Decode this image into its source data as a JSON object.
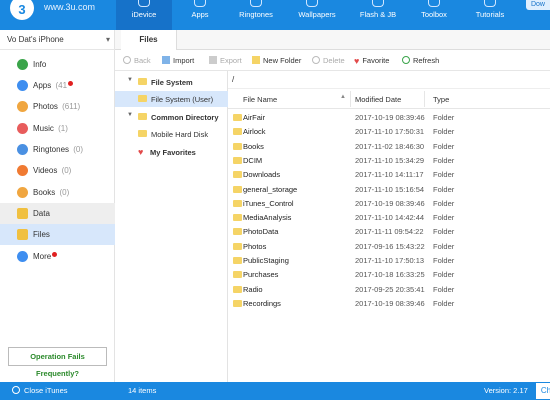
{
  "app": {
    "logo_text": "www.3u.com",
    "top_button": "Dow",
    "nav": [
      {
        "label": "iDevice",
        "active": true
      },
      {
        "label": "Apps"
      },
      {
        "label": "Ringtones"
      },
      {
        "label": "Wallpapers"
      },
      {
        "label": "Flash & JB"
      },
      {
        "label": "Toolbox"
      },
      {
        "label": "Tutorials"
      }
    ]
  },
  "sidebar": {
    "device_name": "Vo Dat's iPhone",
    "items": [
      {
        "label": "Info",
        "count": "",
        "icon": "info-icon",
        "color": "#3aa44a"
      },
      {
        "label": "Apps",
        "count": "(41",
        "icon": "apps-icon",
        "color": "#3e8ef0",
        "dot": true
      },
      {
        "label": "Photos",
        "count": "(611)",
        "icon": "photos-icon",
        "color": "#f0a640"
      },
      {
        "label": "Music",
        "count": "(1)",
        "icon": "music-icon",
        "color": "#e85c5c"
      },
      {
        "label": "Ringtones",
        "count": "(0)",
        "icon": "bell-icon",
        "color": "#4a90e2"
      },
      {
        "label": "Videos",
        "count": "(0)",
        "icon": "video-icon",
        "color": "#f07a32"
      },
      {
        "label": "Books",
        "count": "(0)",
        "icon": "book-icon",
        "color": "#f0a640"
      },
      {
        "label": "Data",
        "count": "",
        "icon": "data-icon",
        "color": "#f0c040"
      },
      {
        "label": "Files",
        "count": "",
        "icon": "files-icon",
        "color": "#f0c040"
      },
      {
        "label": "More",
        "count": "",
        "icon": "more-icon",
        "color": "#3e8ef0",
        "dot": true
      }
    ],
    "operation_fails": "Operation Fails Frequently?"
  },
  "tabs": {
    "files": "Files"
  },
  "toolbar": {
    "back": "Back",
    "import": "Import",
    "export": "Export",
    "new_folder": "New Folder",
    "delete": "Delete",
    "favorite": "Favorite",
    "refresh": "Refresh"
  },
  "tree": {
    "file_system": "File System",
    "file_system_user": "File System (User)",
    "common_directory": "Common Directory",
    "mobile_hard_disk": "Mobile Hard Disk",
    "my_favorites": "My Favorites"
  },
  "filelist": {
    "path": "/",
    "columns": {
      "name": "File Name",
      "modified": "Modified Date",
      "type": "Type"
    },
    "rows": [
      {
        "name": "AirFair",
        "date": "2017-10-19 08:39:46",
        "type": "Folder"
      },
      {
        "name": "Airlock",
        "date": "2017-11-10 17:50:31",
        "type": "Folder"
      },
      {
        "name": "Books",
        "date": "2017-11-02 18:46:30",
        "type": "Folder"
      },
      {
        "name": "DCIM",
        "date": "2017-11-10 15:34:29",
        "type": "Folder"
      },
      {
        "name": "Downloads",
        "date": "2017-11-10 14:11:17",
        "type": "Folder"
      },
      {
        "name": "general_storage",
        "date": "2017-11-10 15:16:54",
        "type": "Folder"
      },
      {
        "name": "iTunes_Control",
        "date": "2017-10-19 08:39:46",
        "type": "Folder"
      },
      {
        "name": "MediaAnalysis",
        "date": "2017-11-10 14:42:44",
        "type": "Folder"
      },
      {
        "name": "PhotoData",
        "date": "2017-11-11 09:54:22",
        "type": "Folder"
      },
      {
        "name": "Photos",
        "date": "2017-09-16 15:43:22",
        "type": "Folder"
      },
      {
        "name": "PublicStaging",
        "date": "2017-11-10 17:50:13",
        "type": "Folder"
      },
      {
        "name": "Purchases",
        "date": "2017-10-18 16:33:25",
        "type": "Folder"
      },
      {
        "name": "Radio",
        "date": "2017-09-25 20:35:41",
        "type": "Folder"
      },
      {
        "name": "Recordings",
        "date": "2017-10-19 08:39:46",
        "type": "Folder"
      }
    ]
  },
  "status": {
    "close_itunes": "Close iTunes",
    "items": "14 items",
    "version": "Version: 2.17",
    "check": "Ch"
  }
}
